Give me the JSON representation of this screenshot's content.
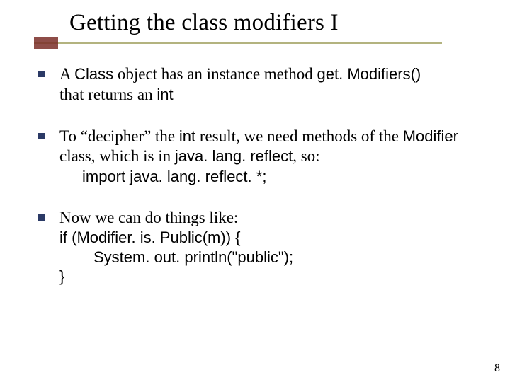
{
  "title": "Getting the class modifiers I",
  "bullets": {
    "b1": {
      "t1": "A ",
      "c1": "Class",
      "t2": " object has an instance method ",
      "c2": "get. Modifiers()",
      "t3": "that returns an ",
      "c3": "int"
    },
    "b2": {
      "t1": "To “decipher” the ",
      "c1": "int",
      "t2": " result, we need methods of the ",
      "c2": "Modifier",
      "t3": " class, which is in ",
      "c3": "java. lang. reflect",
      "t4": ", so:",
      "cline": "import java. lang. reflect. *;"
    },
    "b3": {
      "t1": "Now we can do things like:",
      "l1": "if (Modifier. is. Public(m)) {",
      "l2": "System. out. println(\"public\");",
      "l3": "}"
    }
  },
  "page_number": "8"
}
